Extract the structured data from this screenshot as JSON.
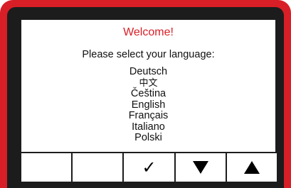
{
  "screen": {
    "title": "Welcome!",
    "prompt": "Please select your language:",
    "languages": [
      "Deutsch",
      "中文",
      "Čeština",
      "English",
      "Français",
      "Italiano",
      "Polski"
    ]
  },
  "softkeys": [
    {
      "label": "",
      "icon": ""
    },
    {
      "label": "",
      "icon": ""
    },
    {
      "label": "✓",
      "icon": "checkmark-icon"
    },
    {
      "label": "",
      "icon": "triangle-down-icon"
    },
    {
      "label": "",
      "icon": "triangle-up-icon"
    }
  ],
  "colors": {
    "frame": "#d81e26",
    "bezel": "#1c1c1c",
    "display_bg": "#ffffff",
    "title": "#d81e26",
    "text": "#111111"
  }
}
